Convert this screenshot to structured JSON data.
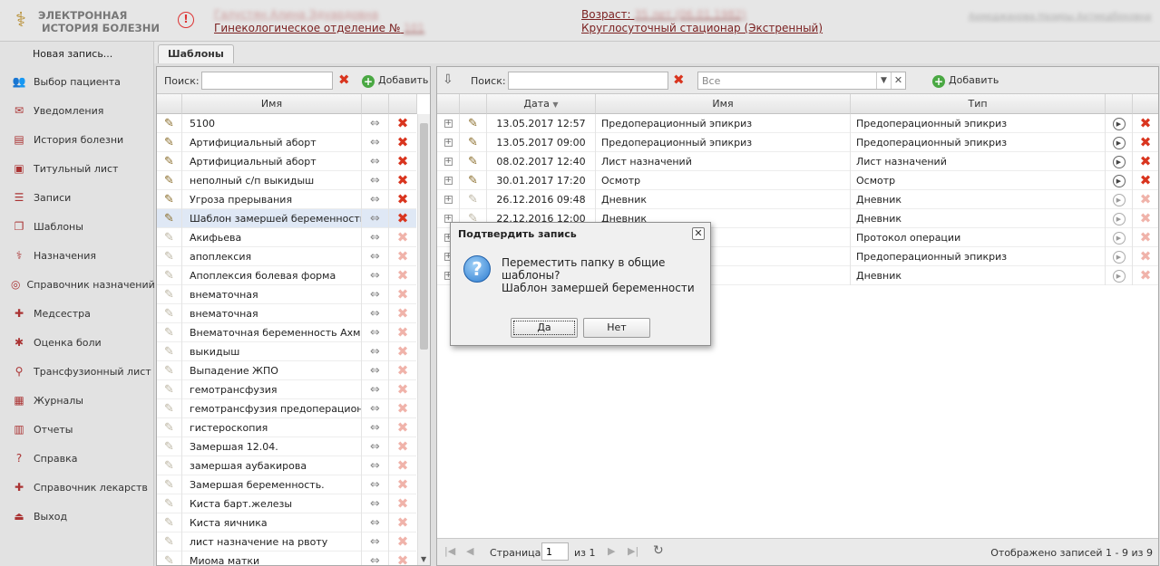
{
  "header": {
    "logo_line1": "ЭЛЕКТРОННАЯ",
    "logo_line2": "ИСТОРИЯ БОЛЕЗНИ",
    "patient_name": "Галустян Алина Эдуардовна",
    "department_prefix": "Гинекологическое отделение №",
    "department_number": "101",
    "age_prefix": "Возраст:",
    "age_value": "35 лет (06.01.1982)",
    "stay_type": "Круглосуточный стационар (Экстренный)",
    "doctor": "Ахмеджанова Назиры Ахтмедбековна"
  },
  "sidebar": {
    "new_entry": "Новая запись...",
    "items": [
      {
        "label": "Выбор пациента",
        "icon": "patients-icon"
      },
      {
        "label": "Уведомления",
        "icon": "mail-icon"
      },
      {
        "label": "История болезни",
        "icon": "history-icon"
      },
      {
        "label": "Титульный лист",
        "icon": "title-page-icon"
      },
      {
        "label": "Записи",
        "icon": "records-icon"
      },
      {
        "label": "Шаблоны",
        "icon": "templates-icon"
      },
      {
        "label": "Назначения",
        "icon": "prescriptions-icon"
      },
      {
        "label": "Справочник назначений",
        "icon": "reference-icon"
      },
      {
        "label": "Медсестра",
        "icon": "nurse-icon"
      },
      {
        "label": "Оценка боли",
        "icon": "pain-icon"
      },
      {
        "label": "Трансфузионный лист",
        "icon": "transfusion-icon"
      },
      {
        "label": "Журналы",
        "icon": "journal-icon"
      },
      {
        "label": "Отчеты",
        "icon": "reports-icon"
      },
      {
        "label": "Справка",
        "icon": "help-icon"
      },
      {
        "label": "Справочник лекарств",
        "icon": "drugs-icon"
      },
      {
        "label": "Выход",
        "icon": "exit-icon"
      }
    ]
  },
  "tab": {
    "label": "Шаблоны"
  },
  "left_panel": {
    "search_label": "Поиск:",
    "search_value": "",
    "add_label": "Добавить",
    "column_name": "Имя",
    "rows": [
      {
        "name": "5100",
        "editable": true
      },
      {
        "name": "Артифициальный аборт",
        "editable": true
      },
      {
        "name": "Артифициальный аборт",
        "editable": true
      },
      {
        "name": "неполный с/п выкидыш",
        "editable": true
      },
      {
        "name": "Угроза прерывания",
        "editable": true
      },
      {
        "name": "Шаблон замершей беременности",
        "editable": true
      },
      {
        "name": "Акифьева",
        "editable": false
      },
      {
        "name": "апоплексия",
        "editable": false
      },
      {
        "name": "Апоплексия болевая форма",
        "editable": false
      },
      {
        "name": "внематочная",
        "editable": false
      },
      {
        "name": "внематочная",
        "editable": false
      },
      {
        "name": "Внематочная беременность Ахме...",
        "editable": false
      },
      {
        "name": "выкидыш",
        "editable": false
      },
      {
        "name": "Выпадение ЖПО",
        "editable": false
      },
      {
        "name": "гемотрансфузия",
        "editable": false
      },
      {
        "name": "гемотрансфузия предоперационн...",
        "editable": false
      },
      {
        "name": "гистероскопия",
        "editable": false
      },
      {
        "name": "Замершая 12.04.",
        "editable": false
      },
      {
        "name": "замершая аубакирова",
        "editable": false
      },
      {
        "name": "Замершая беременность.",
        "editable": false
      },
      {
        "name": "Киста барт.железы",
        "editable": false
      },
      {
        "name": "Киста яичника",
        "editable": false
      },
      {
        "name": "лист назначение на рвоту",
        "editable": false
      },
      {
        "name": "Миома матки",
        "editable": false
      }
    ]
  },
  "right_panel": {
    "search_label": "Поиск:",
    "search_value": "",
    "filter_value": "Все",
    "add_label": "Добавить",
    "columns": {
      "date": "Дата",
      "name": "Имя",
      "type": "Тип"
    },
    "rows": [
      {
        "date": "13.05.2017 12:57",
        "name": "Предоперационный эпикриз",
        "type": "Предоперационный эпикриз",
        "active": true
      },
      {
        "date": "13.05.2017 09:00",
        "name": "Предоперационный эпикриз",
        "type": "Предоперационный эпикриз",
        "active": true
      },
      {
        "date": "08.02.2017 12:40",
        "name": "Лист назначений",
        "type": "Лист назначений",
        "active": true
      },
      {
        "date": "30.01.2017 17:20",
        "name": "Осмотр",
        "type": "Осмотр",
        "active": true
      },
      {
        "date": "26.12.2016 09:48",
        "name": "Дневник",
        "type": "Дневник",
        "active": false
      },
      {
        "date": "22.12.2016 12:00",
        "name": "Дневник",
        "type": "Дневник",
        "active": false
      },
      {
        "date": "",
        "name": "",
        "type": "Протокол операции",
        "active": false
      },
      {
        "date": "",
        "name": "...криз",
        "type": "Предоперационный эпикриз",
        "active": false
      },
      {
        "date": "",
        "name": "",
        "type": "Дневник",
        "active": false
      }
    ],
    "pager": {
      "page_label": "Страница",
      "page_value": "1",
      "of_label": "из 1",
      "status": "Отображено записей 1 - 9 из 9"
    }
  },
  "dialog": {
    "title": "Подтвердить запись",
    "message": "Переместить папку в общие шаблоны?",
    "detail": "Шаблон замершей беременности",
    "yes": "Да",
    "no": "Нет"
  }
}
